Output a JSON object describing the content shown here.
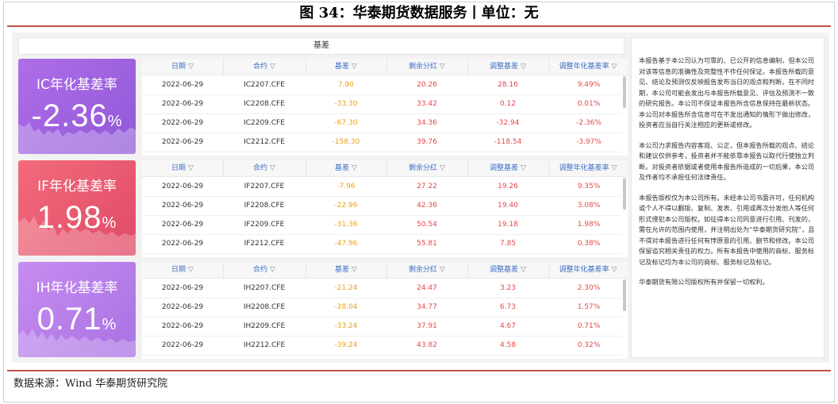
{
  "title": "图 34：华泰期货数据服务丨单位：无",
  "section_header": "基差",
  "columns": [
    "日期",
    "合约",
    "基差",
    "剩余分红",
    "调整基差",
    "调整年化基差率"
  ],
  "filter_icon": "filter-icon",
  "cards": [
    {
      "label": "IC年化基差率",
      "value": "-2.36",
      "unit": "%"
    },
    {
      "label": "IF年化基差率",
      "value": "1.98",
      "unit": "%"
    },
    {
      "label": "IH年化基差率",
      "value": "0.71",
      "unit": "%"
    }
  ],
  "tables": [
    {
      "rows": [
        [
          "2022-06-29",
          "IC2207.CFE",
          "7.90",
          "20.26",
          "28.16",
          "9.49%"
        ],
        [
          "2022-06-29",
          "IC2208.CFE",
          "-33.30",
          "33.42",
          "0.12",
          "0.01%"
        ],
        [
          "2022-06-29",
          "IC2209.CFE",
          "-67.30",
          "34.36",
          "-32.94",
          "-2.36%"
        ],
        [
          "2022-06-29",
          "IC2212.CFE",
          "-158.30",
          "39.76",
          "-118.54",
          "-3.97%"
        ]
      ]
    },
    {
      "rows": [
        [
          "2022-06-29",
          "IF2207.CFE",
          "-7.96",
          "27.22",
          "19.26",
          "9.35%"
        ],
        [
          "2022-06-29",
          "IF2208.CFE",
          "-22.96",
          "42.36",
          "19.40",
          "3.08%"
        ],
        [
          "2022-06-29",
          "IF2209.CFE",
          "-31.36",
          "50.54",
          "19.18",
          "1.98%"
        ],
        [
          "2022-06-29",
          "IF2212.CFE",
          "-47.96",
          "55.81",
          "7.85",
          "0.38%"
        ]
      ]
    },
    {
      "rows": [
        [
          "2022-06-29",
          "IH2207.CFE",
          "-21.24",
          "24.47",
          "3.23",
          "2.30%"
        ],
        [
          "2022-06-29",
          "IH2208.CFE",
          "-28.04",
          "34.77",
          "6.73",
          "1.57%"
        ],
        [
          "2022-06-29",
          "IH2209.CFE",
          "-33.24",
          "37.91",
          "4.67",
          "0.71%"
        ],
        [
          "2022-06-29",
          "IH2212.CFE",
          "-39.24",
          "43.82",
          "4.58",
          "0.32%"
        ]
      ]
    }
  ],
  "disclaimer": [
    "本报告基于本公司认为可靠的、已公开的信息编制，但本公司对该等信息的准确性及完整性不作任何保证。本报告所载的意见、结论及预测仅反映报告发布当日的观点和判断。在不同时期，本公司可能会发出与本报告所载意见、评估及预测不一致的研究报告。本公司不保证本报告所含信息保持在最新状态。本公司对本报告所含信息可在不发出通知的情形下做出修改，投资者应当自行关注相应的更新或修改。",
    "本公司力求报告内容客观、公正，但本报告所载的观点、结论和建议仅供参考，投资者并不能依靠本报告以取代行使独立判断。对投资者依据或者使用本报告所造成的一切后果，本公司及作者均不承担任何法律责任。",
    "本报告版权仅为本公司所有。未经本公司书面许可，任何机构或个人不得以翻版、复制、发表、引用或再次分发他人等任何形式侵犯本公司版权。如征得本公司同意进行引用、刊发的，需在允许的范围内使用，并注明出处为“华泰期货研究院”，且不得对本报告进行任何有悖原意的引用、删节和修改。本公司保留追究相关责任的权力。所有本报告中使用的商标、服务标记及标记均为本公司的商标、服务标记及标记。",
    "华泰期货有限公司版权所有并保留一切权利。"
  ],
  "source": "数据来源：Wind  华泰期货研究院"
}
